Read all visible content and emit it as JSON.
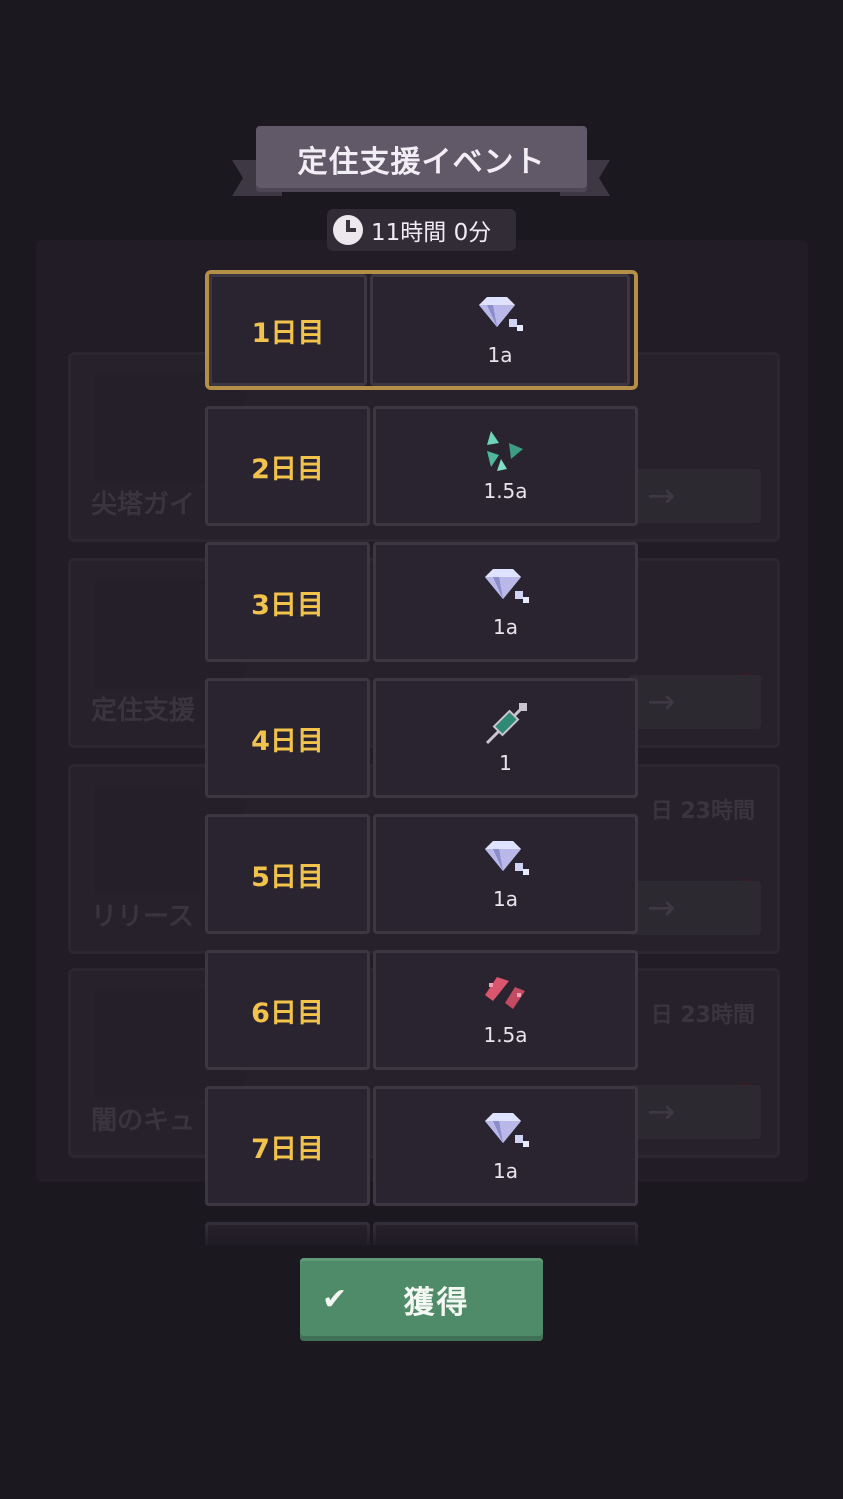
{
  "background": {
    "cards": [
      {
        "title": "尖塔ガイ",
        "timer": ""
      },
      {
        "title": "定住支援",
        "timer": ""
      },
      {
        "title": "リリース",
        "timer": "日 23時間"
      },
      {
        "title": "闇のキュ",
        "timer": "日 23時間"
      }
    ],
    "arrow": "→"
  },
  "modal": {
    "title": "定住支援イベント",
    "timer": "11時間 0分",
    "days": [
      {
        "label": "1日目",
        "amount": "1a",
        "icon": "diamond-icon",
        "selected": true
      },
      {
        "label": "2日目",
        "amount": "1.5a",
        "icon": "teal-shards-icon",
        "selected": false
      },
      {
        "label": "3日目",
        "amount": "1a",
        "icon": "diamond-icon",
        "selected": false
      },
      {
        "label": "4日目",
        "amount": "1",
        "icon": "syringe-icon",
        "selected": false
      },
      {
        "label": "5日目",
        "amount": "1a",
        "icon": "diamond-icon",
        "selected": false
      },
      {
        "label": "6日目",
        "amount": "1.5a",
        "icon": "red-shards-icon",
        "selected": false
      },
      {
        "label": "7日目",
        "amount": "1a",
        "icon": "diamond-icon",
        "selected": false
      }
    ],
    "claim_button": {
      "label": "獲得",
      "check": "✔"
    }
  },
  "colors": {
    "day_text": "#f1c24c",
    "selected_border": "#b38f47",
    "claim_button": "#4f8b68"
  }
}
